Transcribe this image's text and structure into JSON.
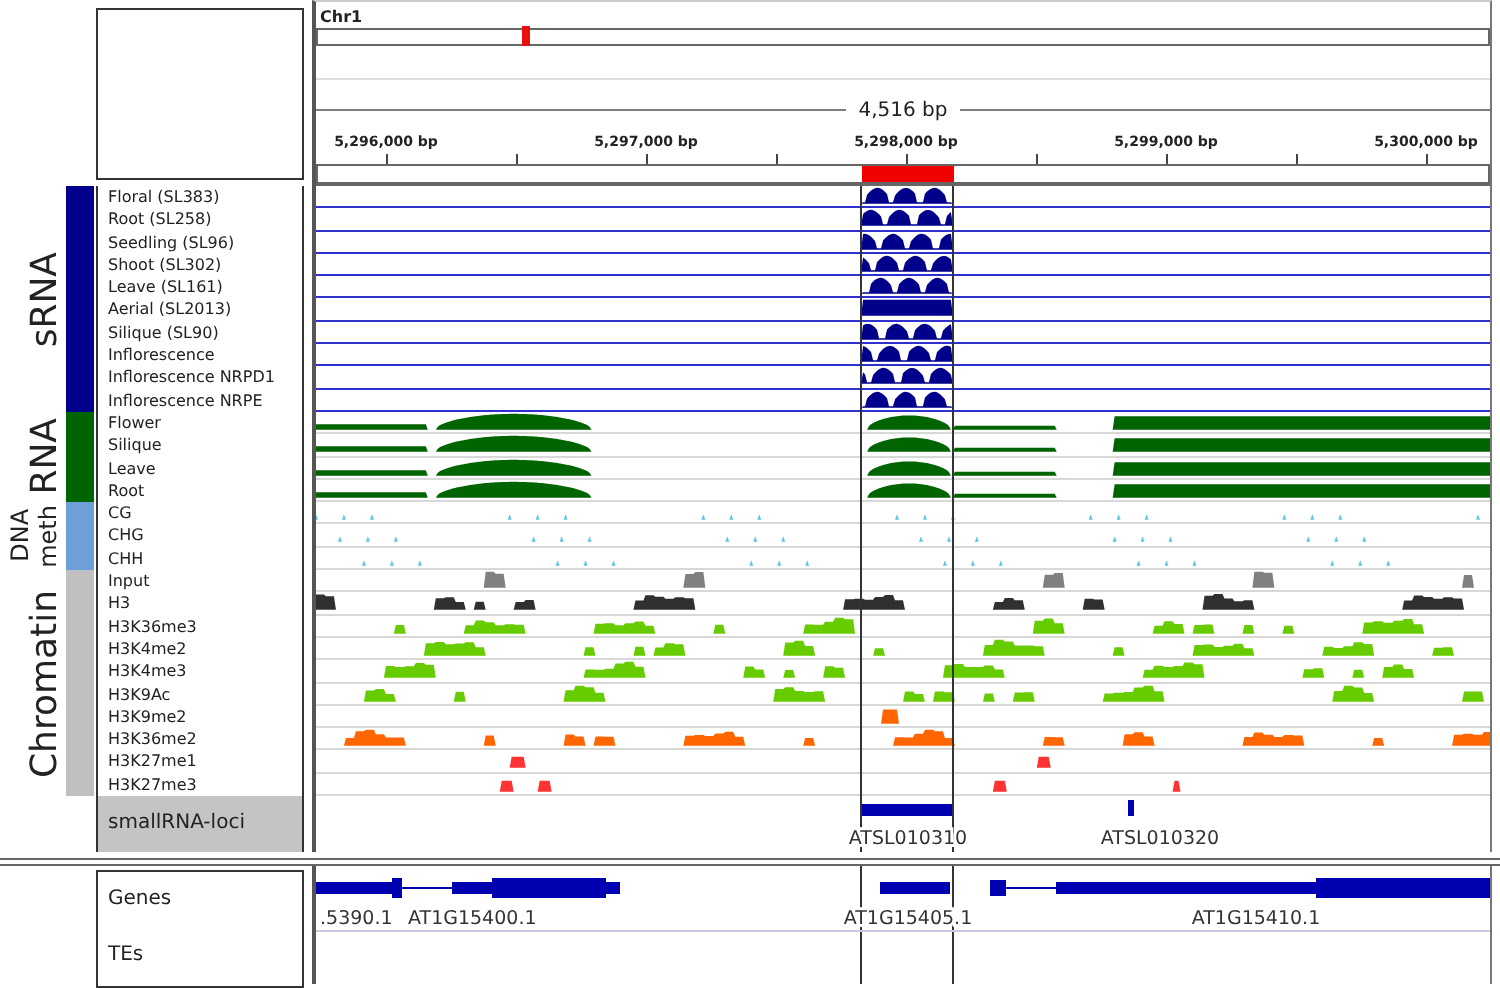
{
  "chromosome": {
    "name": "Chr1"
  },
  "ruler": {
    "span": "4,516 bp",
    "ticks": [
      "5,296,000 bp",
      "5,297,000 bp",
      "5,298,000 bp",
      "5,299,000 bp",
      "5,300,000 bp"
    ]
  },
  "groups": [
    {
      "label": "sRNA",
      "color": "#00008b",
      "kind": "srna",
      "tracks": [
        {
          "name": "Floral (SL383)",
          "color": "#00008b"
        },
        {
          "name": "Root (SL258)",
          "color": "#00008b"
        },
        {
          "name": "Seedling (SL96)",
          "color": "#00008b"
        },
        {
          "name": "Shoot (SL302)",
          "color": "#00008b"
        },
        {
          "name": "Leave (SL161)",
          "color": "#00008b"
        },
        {
          "name": "Aerial (SL2013)",
          "color": "#00008b"
        },
        {
          "name": "Silique (SL90)",
          "color": "#00008b"
        },
        {
          "name": "Inflorescence",
          "color": "#00008b"
        },
        {
          "name": "Inflorescence NRPD1",
          "color": "#00008b"
        },
        {
          "name": "Inflorescence NRPE",
          "color": "#00008b"
        }
      ]
    },
    {
      "label": "RNA",
      "color": "#006400",
      "kind": "rna",
      "tracks": [
        {
          "name": "Flower",
          "color": "#006400"
        },
        {
          "name": "Silique",
          "color": "#006400"
        },
        {
          "name": "Leave",
          "color": "#006400"
        },
        {
          "name": "Root",
          "color": "#006400"
        }
      ]
    },
    {
      "label": "DNA meth",
      "color": "#6f9fd8",
      "kind": "meth",
      "tracks": [
        {
          "name": "CG",
          "color": "#5bc8e8"
        },
        {
          "name": "CHG",
          "color": "#5bc8e8"
        },
        {
          "name": "CHH",
          "color": "#5bc8e8"
        }
      ]
    },
    {
      "label": "Chromatin",
      "color": "#c0c0c0",
      "kind": "chromatin",
      "tracks": [
        {
          "name": "Input",
          "color": "#808080"
        },
        {
          "name": "H3",
          "color": "#303030"
        },
        {
          "name": "H3K36me3",
          "color": "#66cc00"
        },
        {
          "name": "H3K4me2",
          "color": "#66cc00"
        },
        {
          "name": "H3K4me3",
          "color": "#66cc00"
        },
        {
          "name": "H3K9Ac",
          "color": "#66cc00"
        },
        {
          "name": "H3K9me2",
          "color": "#ff6600"
        },
        {
          "name": "H3K36me2",
          "color": "#ff6600"
        },
        {
          "name": "H3K27me1",
          "color": "#ff3333"
        },
        {
          "name": "H3K27me3",
          "color": "#ff3333"
        }
      ]
    }
  ],
  "loci_track": {
    "name": "smallRNA-loci",
    "features": [
      "ATSL010310",
      "ATSL010320"
    ]
  },
  "annotation_tracks": [
    {
      "name": "Genes",
      "features": [
        ".5390.1",
        "AT1G15400.1",
        "AT1G15405.1",
        "AT1G15410.1"
      ]
    },
    {
      "name": "TEs"
    }
  ]
}
